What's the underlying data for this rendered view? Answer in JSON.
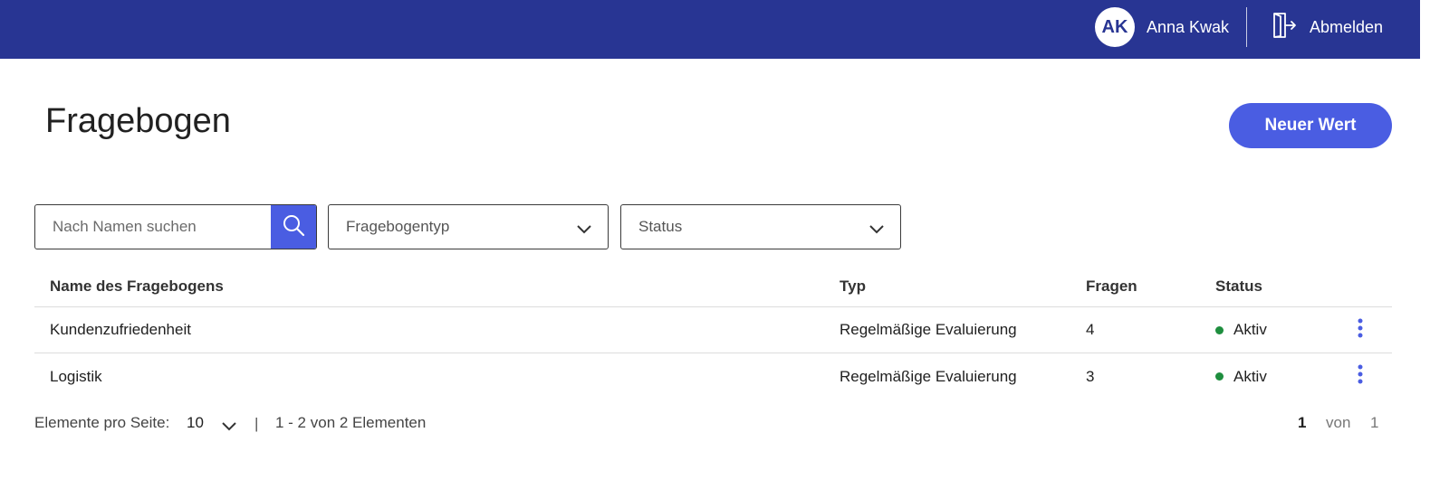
{
  "header": {
    "user_initials": "AK",
    "user_name": "Anna Kwak",
    "logout_label": "Abmelden"
  },
  "page": {
    "title": "Fragebogen",
    "new_button_label": "Neuer Wert"
  },
  "filters": {
    "search_placeholder": "Nach Namen suchen",
    "type_select": "Fragebogentyp",
    "status_select": "Status"
  },
  "table": {
    "columns": [
      "Name des Fragebogens",
      "Typ",
      "Fragen",
      "Status"
    ],
    "rows": [
      {
        "name": "Kundenzufriedenheit",
        "type": "Regelmäßige Evaluierung",
        "questions": "4",
        "status": "Aktiv"
      },
      {
        "name": "Logistik",
        "type": "Regelmäßige Evaluierung",
        "questions": "3",
        "status": "Aktiv"
      }
    ]
  },
  "pagination": {
    "per_page_label": "Elemente pro Seite:",
    "per_page_value": "10",
    "separator": "|",
    "range_text": "1 - 2 von 2 Elementen",
    "current_page": "1",
    "of_label": "von",
    "total_pages": "1"
  },
  "colors": {
    "header_bg": "#283593",
    "primary": "#4a5de2",
    "status_active": "#1e8e3e"
  },
  "icons": {
    "search": "search-icon",
    "logout": "logout-icon",
    "dropdown": "chevron-down-icon",
    "row_menu": "more-vertical-icon"
  }
}
